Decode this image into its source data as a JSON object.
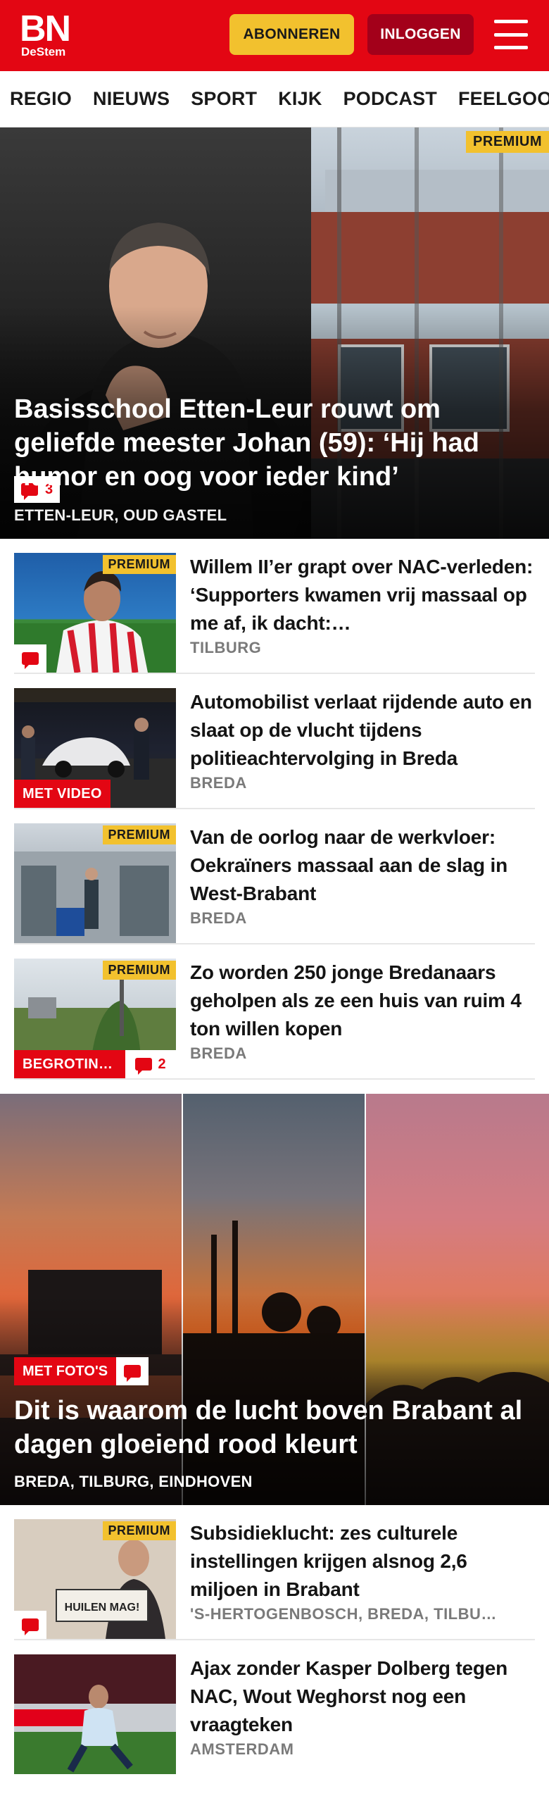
{
  "header": {
    "logo_main": "BN",
    "logo_sub": "DeStem",
    "subscribe_label": "ABONNEREN",
    "login_label": "INLOGGEN",
    "brand_color": "#e30613"
  },
  "nav": {
    "items": [
      "REGIO",
      "NIEUWS",
      "SPORT",
      "KIJK",
      "PODCAST",
      "FEELGOOD"
    ]
  },
  "hero": {
    "premium": "PREMIUM",
    "comments": "3",
    "title": "Basisschool Etten-Leur rouwt om geliefde meester Johan (59): ‘Hij had humor en oog voor ieder kind’",
    "location": "ETTEN-LEUR, OUD GASTEL"
  },
  "articles": [
    {
      "premium": "PREMIUM",
      "title": "Willem II’er grapt over NAC-verleden: ‘Supporters kwamen vrij massaal op me af, ik dacht:…",
      "location": "TILBURG"
    },
    {
      "label": "MET VIDEO",
      "title": "Automobilist verlaat rijdende auto en slaat op de vlucht tijdens politieachtervolging in Breda",
      "location": "BREDA"
    },
    {
      "premium": "PREMIUM",
      "title": "Van de oorlog naar de werkvloer: Oekraïners massaal aan de slag in West-Brabant",
      "location": "BREDA"
    },
    {
      "premium": "PREMIUM",
      "label": "BEGROTIN…",
      "comments": "2",
      "title": "Zo worden 250 jonge Bredanaars geholpen als ze een huis van ruim 4 ton willen kopen",
      "location": "BREDA"
    }
  ],
  "hero2": {
    "label": "MET FOTO'S",
    "title": "Dit is waarom de lucht boven Brabant al dagen gloeiend rood kleurt",
    "location": "BREDA, TILBURG, EINDHOVEN"
  },
  "articles2": [
    {
      "premium": "PREMIUM",
      "sign_text": "HUILEN MAG!",
      "title": "Subsidieklucht: zes culturele instellingen krijgen alsnog 2,6 miljoen in Brabant",
      "location": "'S-HERTOGENBOSCH, BREDA, TILBU…"
    },
    {
      "title": "Ajax zonder Kasper Dolberg tegen NAC, Wout Weghorst nog een vraagteken",
      "location": "AMSTERDAM"
    }
  ]
}
